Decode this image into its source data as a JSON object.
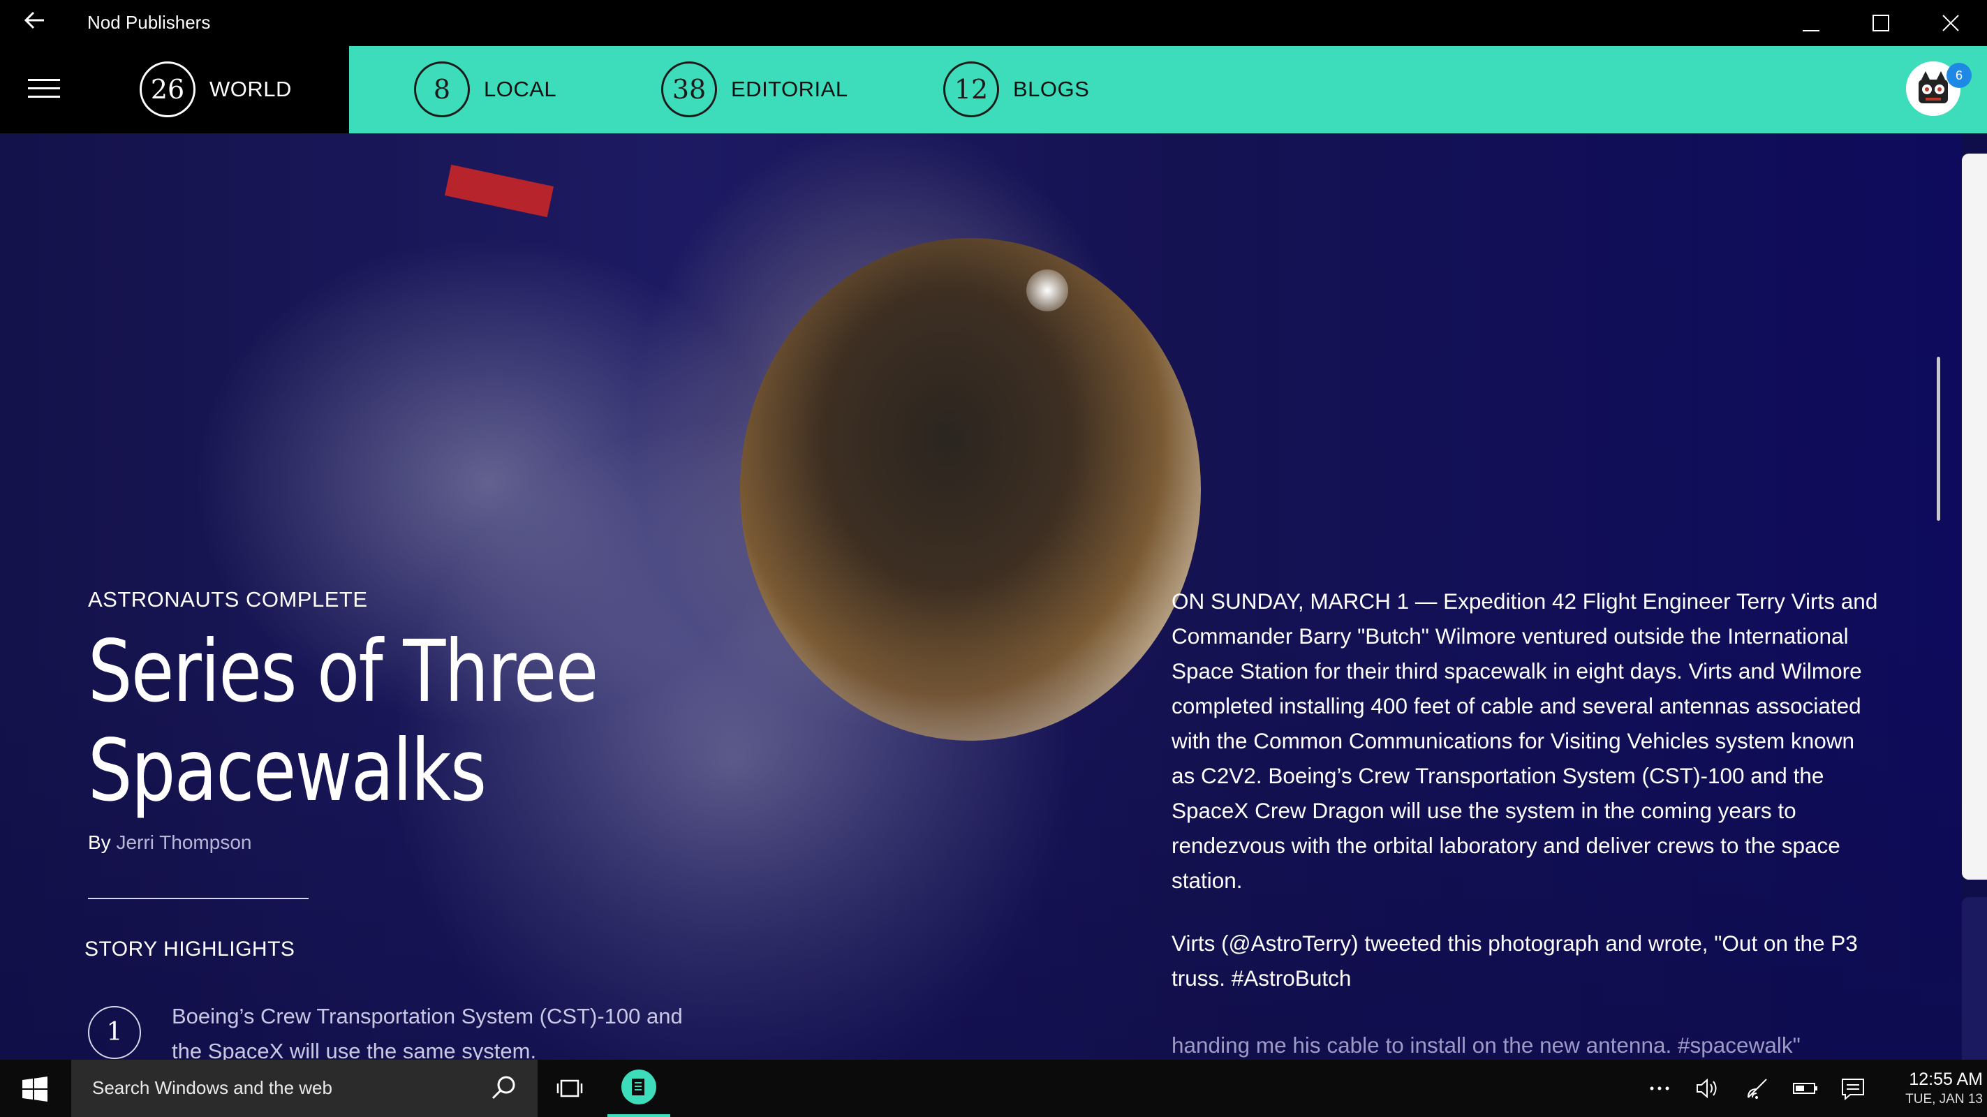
{
  "window": {
    "title": "Nod Publishers"
  },
  "nav": {
    "items": [
      {
        "count": "26",
        "label": "WORLD"
      },
      {
        "count": "8",
        "label": "LOCAL"
      },
      {
        "count": "38",
        "label": "EDITORIAL"
      },
      {
        "count": "12",
        "label": "BLOGS"
      }
    ],
    "notification_count": "6"
  },
  "article": {
    "kicker": "ASTRONAUTS COMPLETE",
    "headline_line1": "Series of Three",
    "headline_line2": "Spacewalks",
    "byline_prefix": "By",
    "author": "Jerri Thompson",
    "highlights_title": "STORY HIGHLIGHTS",
    "highlights": [
      {
        "number": "1",
        "text": "Boeing’s Crew Transportation System (CST)-100 and the SpaceX will use the same system."
      }
    ],
    "paragraphs": [
      "ON SUNDAY, MARCH 1 — Expedition 42 Flight Engineer Terry Virts and Commander Barry \"Butch\" Wilmore ventured outside the International Space Station for their third spacewalk in eight days. Virts and Wilmore completed installing 400 feet of cable and several antennas associated with the Common Communications for Visiting Vehicles system known as C2V2. Boeing’s Crew Transportation System (CST)-100 and the SpaceX Crew Dragon will use the system in the coming years to rendezvous with the orbital laboratory and deliver crews to the space station.",
      "Virts (@AstroTerry) tweeted this photograph and wrote, \"Out on the P3 truss. #AstroButch",
      "handing me his cable to install on the new antenna. #spacewalk\""
    ]
  },
  "taskbar": {
    "search_placeholder": "Search Windows and the web",
    "time": "12:55 AM",
    "date": "TUE, JAN 13"
  },
  "colors": {
    "accent": "#3ddcbb",
    "titlebar": "#000000",
    "hero_bg": "#14124a"
  },
  "icons": [
    "back-arrow-icon",
    "minimize-icon",
    "maximize-icon",
    "close-icon",
    "hamburger-menu-icon",
    "avatar",
    "windows-start-icon",
    "search-icon",
    "task-view-icon",
    "app-icon",
    "more-icon",
    "volume-icon",
    "wifi-icon",
    "battery-icon",
    "notifications-icon"
  ]
}
